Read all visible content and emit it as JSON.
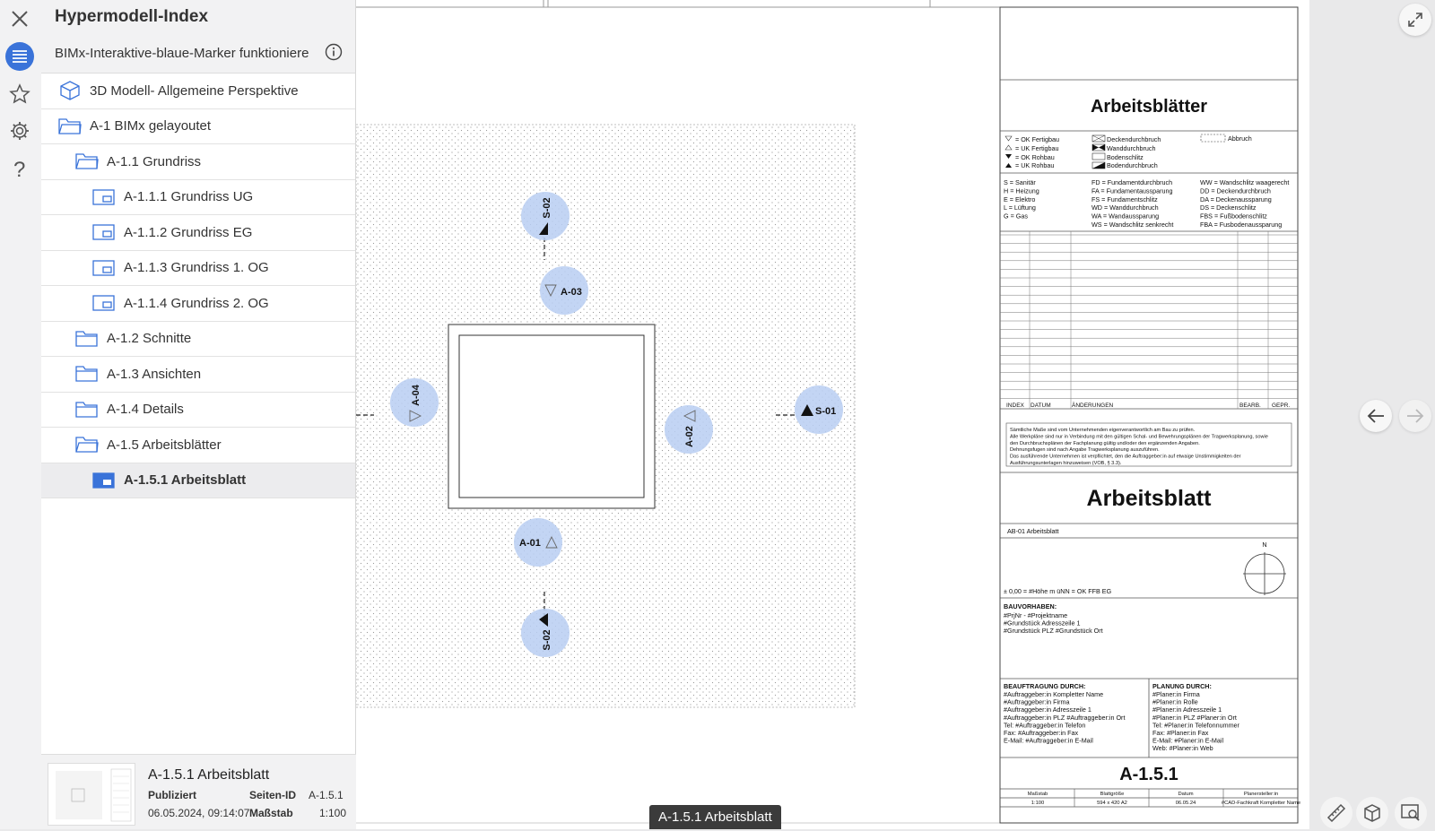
{
  "panel": {
    "title": "Hypermodell-Index",
    "subtitle": "BIMx-Interaktive-blaue-Marker funktioniere",
    "items": [
      {
        "label": "3D Modell- Allgemeine Perspektive",
        "icon": "cube-icon",
        "level": 0
      },
      {
        "label": "A-1 BIMx gelayoutet",
        "icon": "folder-open-icon",
        "level": 0
      },
      {
        "label": "A-1.1 Grundriss",
        "icon": "folder-open-icon",
        "level": 1
      },
      {
        "label": "A-1.1.1 Grundriss UG",
        "icon": "layout-icon",
        "level": 2
      },
      {
        "label": "A-1.1.2 Grundriss EG",
        "icon": "layout-icon",
        "level": 2
      },
      {
        "label": "A-1.1.3 Grundriss 1. OG",
        "icon": "layout-icon",
        "level": 2
      },
      {
        "label": "A-1.1.4 Grundriss 2. OG",
        "icon": "layout-icon",
        "level": 2
      },
      {
        "label": "A-1.2 Schnitte",
        "icon": "folder-icon",
        "level": 1
      },
      {
        "label": "A-1.3 Ansichten",
        "icon": "folder-icon",
        "level": 1
      },
      {
        "label": "A-1.4 Details",
        "icon": "folder-icon",
        "level": 1
      },
      {
        "label": "A-1.5 Arbeitsblätter",
        "icon": "folder-open-icon",
        "level": 1
      },
      {
        "label": "A-1.5.1 Arbeitsblatt",
        "icon": "layout-filled-icon",
        "level": 2,
        "selected": true
      }
    ],
    "info": {
      "title": "A-1.5.1 Arbeitsblatt",
      "status": "Publiziert",
      "date": "06.05.2024, 09:14:07",
      "page_id_label": "Seiten-ID",
      "page_id": "A-1.5.1",
      "scale_label": "Maßstab",
      "scale": "1:100"
    }
  },
  "drawing": {
    "markers": {
      "s02_top": "S-02",
      "a03": "A-03",
      "a04": "A-04",
      "a02": "A-02",
      "s01": "S-01",
      "a01": "A-01",
      "s02_bottom": "S-02"
    }
  },
  "titleblock": {
    "header": "Arbeitsblätter",
    "legend_symbols": [
      "= OK Fertigbau",
      "= UK Fertigbau",
      "= OK Rohbau",
      "= UK Rohbau"
    ],
    "legend_openings": [
      "Deckendurchbruch",
      "Wanddurchbruch",
      "Bodenschlitz",
      "Bodendurchbruch"
    ],
    "legend_abbruch": "Abbruch",
    "abbr_col1": [
      "S = Sanitär",
      "H = Heizung",
      "E = Elektro",
      "L = Lüftung",
      "G = Gas"
    ],
    "abbr_col2": [
      "FD = Fundamentdurchbruch",
      "FA = Fundamentaussparung",
      "FS = Fundamentschlitz",
      "WD = Wanddurchbruch",
      "WA = Wandaussparung",
      "WS = Wandschlitz senkrecht"
    ],
    "abbr_col3": [
      "WW = Wandschlitz waagerecht",
      "DD = Deckendurchbruch",
      "DA = Deckenaussparung",
      "DS = Deckenschlitz",
      "FBS = Fußbodenschlitz",
      "FBA = Fusbodenaussparung"
    ],
    "rev_headers": [
      "INDEX",
      "DATUM",
      "ÄNDERUNGEN",
      "BEARB.",
      "GEPR."
    ],
    "note": [
      "Sämtliche Maße sind vom Unternehmenden eigenverantwortlich am Bau zu prüfen.",
      "Alle Werkpläne sind nur in Verbindung mit den gültigen Schal- und Bewehrungsplänen der Tragwerksplanung, sowie",
      "den Durchbruchsplänen der Fachplanung gültig und/oder den ergänzenden Angaben.",
      "Dehnungsfugen sind nach Angabe Tragwerksplanung auszuführen.",
      "Das ausführende Unternehmen ist verpflichtet, den die Auftraggeber:in auf etwaige Unstimmigkeiten der",
      "Ausführungsunterlagen hinzuweisen (VOB, § 3.3)."
    ],
    "sheet_title": "Arbeitsblatt",
    "sheet_sub": "AB-01 Arbeitsblatt",
    "north": "N",
    "height_ref": "± 0,00 = #Höhe m üNN = OK FFB EG",
    "project_label": "BAUVORHABEN:",
    "project_lines": [
      "#PrjNr - #Projektname",
      "#Grundstück Adresszeile 1",
      "#Grundstück PLZ #Grundstück Ort"
    ],
    "client_label": "BEAUFTRAGUNG DURCH:",
    "client_lines": [
      "#Auftraggeber:in Kompletter Name",
      "#Auftraggeber:in Firma",
      "#Auftraggeber:in Adresszeile 1",
      "#Auftraggeber:in PLZ #Auftraggeber:in Ort",
      "Tel: #Auftraggeber:in Telefon",
      "Fax: #Auftraggeber:in Fax",
      "E-Mail: #Auftraggeber:in E-Mail"
    ],
    "planner_label": "PLANUNG DURCH:",
    "planner_lines": [
      "#Planer:in Firma",
      "#Planer:in Rolle",
      "#Planer:in Adresszeile 1",
      "#Planer:in PLZ #Planer:in Ort",
      "Tel: #Planer:in Telefonnummer",
      "Fax: #Planer:in Fax",
      "E-Mail: #Planer:in E-Mail",
      "Web: #Planer:in Web"
    ],
    "sheet_number": "A-1.5.1",
    "footer_labels": [
      "Maßstab",
      "Blattgröße",
      "Datum",
      "Planersteller:in"
    ],
    "footer_values": [
      "1:100",
      "594 x 420 A2",
      "06.05.24",
      "#CAD-Fachkraft Kompletter Name"
    ]
  },
  "caption": "A-1.5.1 Arbeitsblatt"
}
